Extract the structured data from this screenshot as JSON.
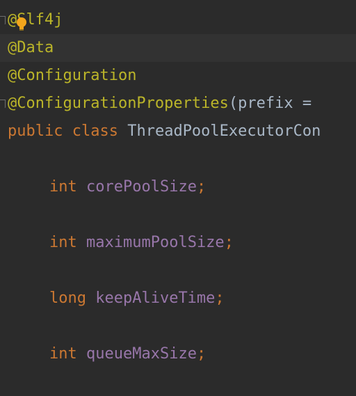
{
  "colors": {
    "background": "#2b2b2b",
    "current_line": "#323232",
    "annotation": "#bbb529",
    "keyword": "#cc7832",
    "field": "#9876aa",
    "plain": "#a9b7c6"
  },
  "editor": {
    "lines": [
      {
        "at": "@",
        "name": "Slf4j"
      },
      {
        "at": "@",
        "name": "Data"
      },
      {
        "at": "@",
        "name": "Configuration"
      },
      {
        "at": "@",
        "name": "ConfigurationProperties",
        "open_paren": "(",
        "param": "prefix ="
      },
      {
        "kw1": "public",
        "kw2": "class",
        "class_name": "ThreadPoolExecutorCon"
      }
    ],
    "fields": [
      {
        "type": "int",
        "name": "corePoolSize",
        "semi": ";"
      },
      {
        "type": "int",
        "name": "maximumPoolSize",
        "semi": ";"
      },
      {
        "type": "long",
        "name": "keepAliveTime",
        "semi": ";"
      },
      {
        "type": "int",
        "name": "queueMaxSize",
        "semi": ";"
      }
    ],
    "intention_icon": "lightbulb-icon"
  }
}
